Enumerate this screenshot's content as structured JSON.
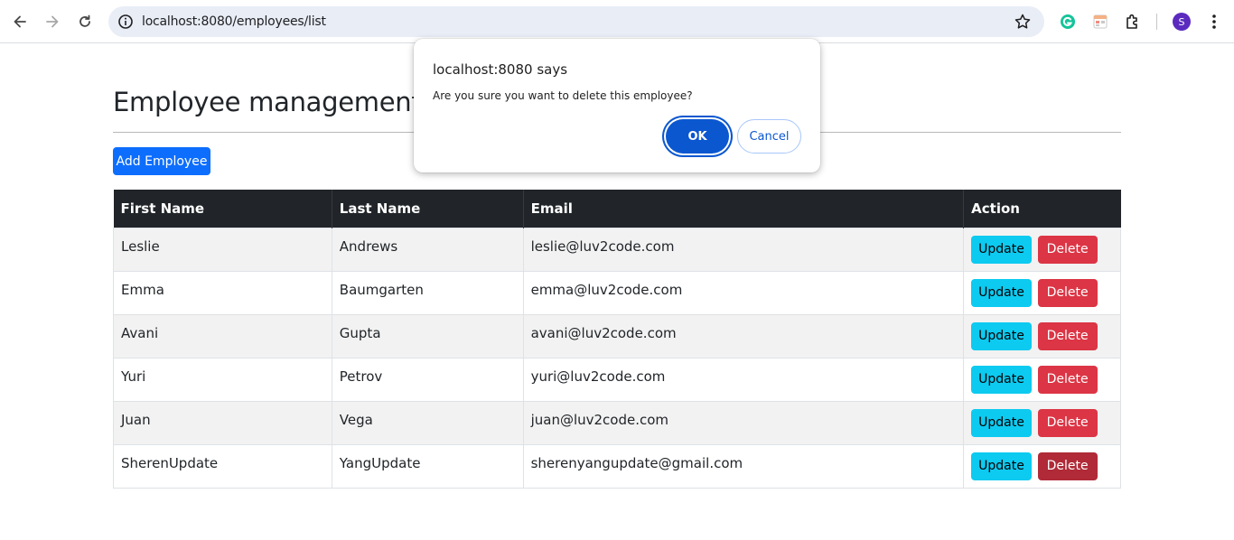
{
  "browser": {
    "url": "localhost:8080/employees/list",
    "avatar_letter": "S",
    "icons": [
      "back-icon",
      "forward-icon",
      "reload-icon",
      "site-info-icon",
      "bookmark-star-icon",
      "grammarly-icon",
      "extension-icon",
      "puzzle-icon",
      "menu-kebab-icon"
    ]
  },
  "page": {
    "title": "Employee management",
    "add_button": "Add Employee"
  },
  "table": {
    "headers": [
      "First Name",
      "Last Name",
      "Email",
      "Action"
    ],
    "update_label": "Update",
    "delete_label": "Delete",
    "rows": [
      {
        "first": "Leslie",
        "last": "Andrews",
        "email": "leslie@luv2code.com"
      },
      {
        "first": "Emma",
        "last": "Baumgarten",
        "email": "emma@luv2code.com"
      },
      {
        "first": "Avani",
        "last": "Gupta",
        "email": "avani@luv2code.com"
      },
      {
        "first": "Yuri",
        "last": "Petrov",
        "email": "yuri@luv2code.com"
      },
      {
        "first": "Juan",
        "last": "Vega",
        "email": "juan@luv2code.com"
      },
      {
        "first": "SherenUpdate",
        "last": "YangUpdate",
        "email": "sherenyangupdate@gmail.com"
      }
    ]
  },
  "dialog": {
    "title": "localhost:8080 says",
    "message": "Are you sure you want to delete this employee?",
    "ok_label": "OK",
    "cancel_label": "Cancel"
  },
  "colors": {
    "primary": "#0d6efd",
    "info": "#0dcaf0",
    "danger": "#dc3545",
    "dark": "#212529",
    "dialog_accent": "#0b57d0"
  }
}
